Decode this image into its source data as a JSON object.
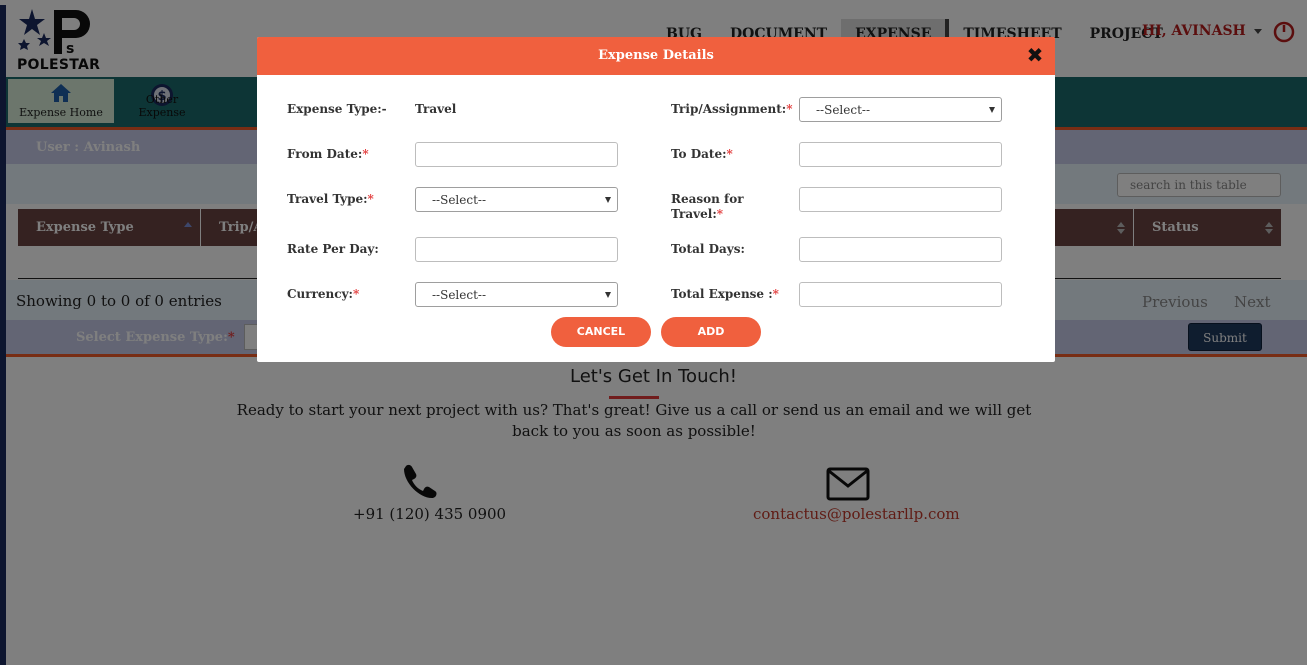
{
  "brand": {
    "logo_text": "POLESTAR"
  },
  "nav": {
    "items": [
      "BUG",
      "DOCUMENT",
      "EXPENSE",
      "TIMESHEET",
      "PROJECT"
    ],
    "active": "EXPENSE",
    "user_greeting": "HI, AVINASH"
  },
  "toolbar": {
    "home_label": "Expense Home",
    "other_label": "Other Expense"
  },
  "page": {
    "user_label": "User : Avinash",
    "search_placeholder": "search in this table",
    "columns": [
      "Expense Type",
      "Trip/A",
      "",
      "Status"
    ],
    "showing": "Showing 0 to 0 of 0 entries",
    "prev": "Previous",
    "next": "Next",
    "select_expense_label": "Select Expense Type:",
    "submit": "Submit"
  },
  "footer": {
    "title": "Let's Get In Touch!",
    "text": "Ready to start your next project with us? That's great! Give us a call or send us an email and we will get back to you as soon as possible!",
    "phone": "+91 (120) 435 0900",
    "email": "contactus@polestarllp.com"
  },
  "modal": {
    "title": "Expense Details",
    "close": "✖",
    "expense_type_label": "Expense Type:-",
    "expense_type_value": "Travel",
    "trip_label": "Trip/Assignment:",
    "trip_select": "--Select--",
    "from_date_label": "From Date:",
    "to_date_label": "To Date:",
    "travel_type_label": "Travel Type:",
    "travel_type_select": "--Select--",
    "reason_label_1": "Reason for",
    "reason_label_2": "Travel:",
    "rate_label": "Rate Per Day:",
    "total_days_label": "Total Days:",
    "currency_label": "Currency:",
    "currency_select": "--Select--",
    "total_expense_label": "Total Expense :",
    "required_mark": "*",
    "cancel": "CANCEL",
    "add": "ADD"
  },
  "colors": {
    "accent": "#f0603e",
    "toolbar": "#1a6b6d",
    "table_header": "#6a4542",
    "error": "#e23b3b"
  }
}
